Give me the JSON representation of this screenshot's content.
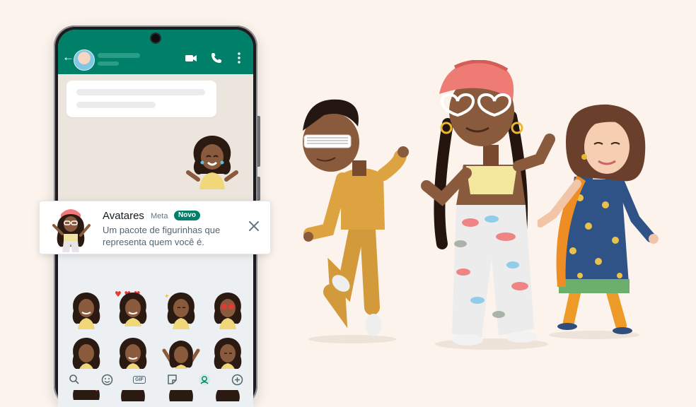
{
  "notification": {
    "title": "Avatares",
    "publisher": "Meta",
    "badge": "Novo",
    "description": "Um pacote de figurinhas que representa quem você é."
  },
  "icons": {
    "back": "arrow-left-icon",
    "video": "video-camera-icon",
    "call": "phone-icon",
    "menu": "more-vertical-icon",
    "close": "close-icon",
    "keyboard_bar": [
      "search-icon",
      "emoji-icon",
      "gif-icon",
      "sticker-icon",
      "avatar-sticker-icon",
      "add-icon"
    ]
  },
  "colors": {
    "brand": "#008069",
    "background": "#fbf3ec",
    "chat_background": "#ece5dd"
  },
  "keyboard_bar": {
    "gif_label": "GIF"
  }
}
